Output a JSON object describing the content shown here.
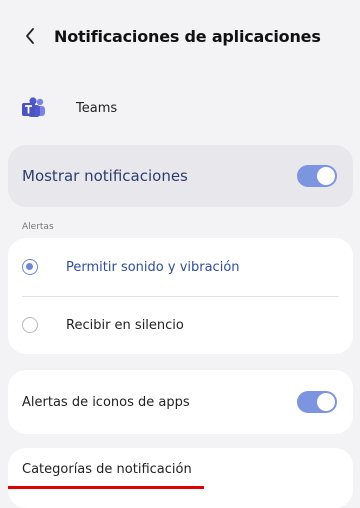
{
  "header": {
    "title": "Notificaciones de aplicaciones",
    "back_icon": "chevron-left-icon"
  },
  "app": {
    "name": "Teams",
    "icon": "teams-icon"
  },
  "show_notifications": {
    "label": "Mostrar notificaciones",
    "enabled": true
  },
  "alerts_section": {
    "label": "Alertas",
    "options": [
      {
        "label": "Permitir sonido y vibración",
        "selected": true
      },
      {
        "label": "Recibir en silencio",
        "selected": false
      }
    ]
  },
  "badges": {
    "label": "Alertas de iconos de apps",
    "enabled": true
  },
  "categories": {
    "label": "Categorías de notificación"
  },
  "colors": {
    "accent": "#7c95e0",
    "annotation": "#e00000"
  }
}
